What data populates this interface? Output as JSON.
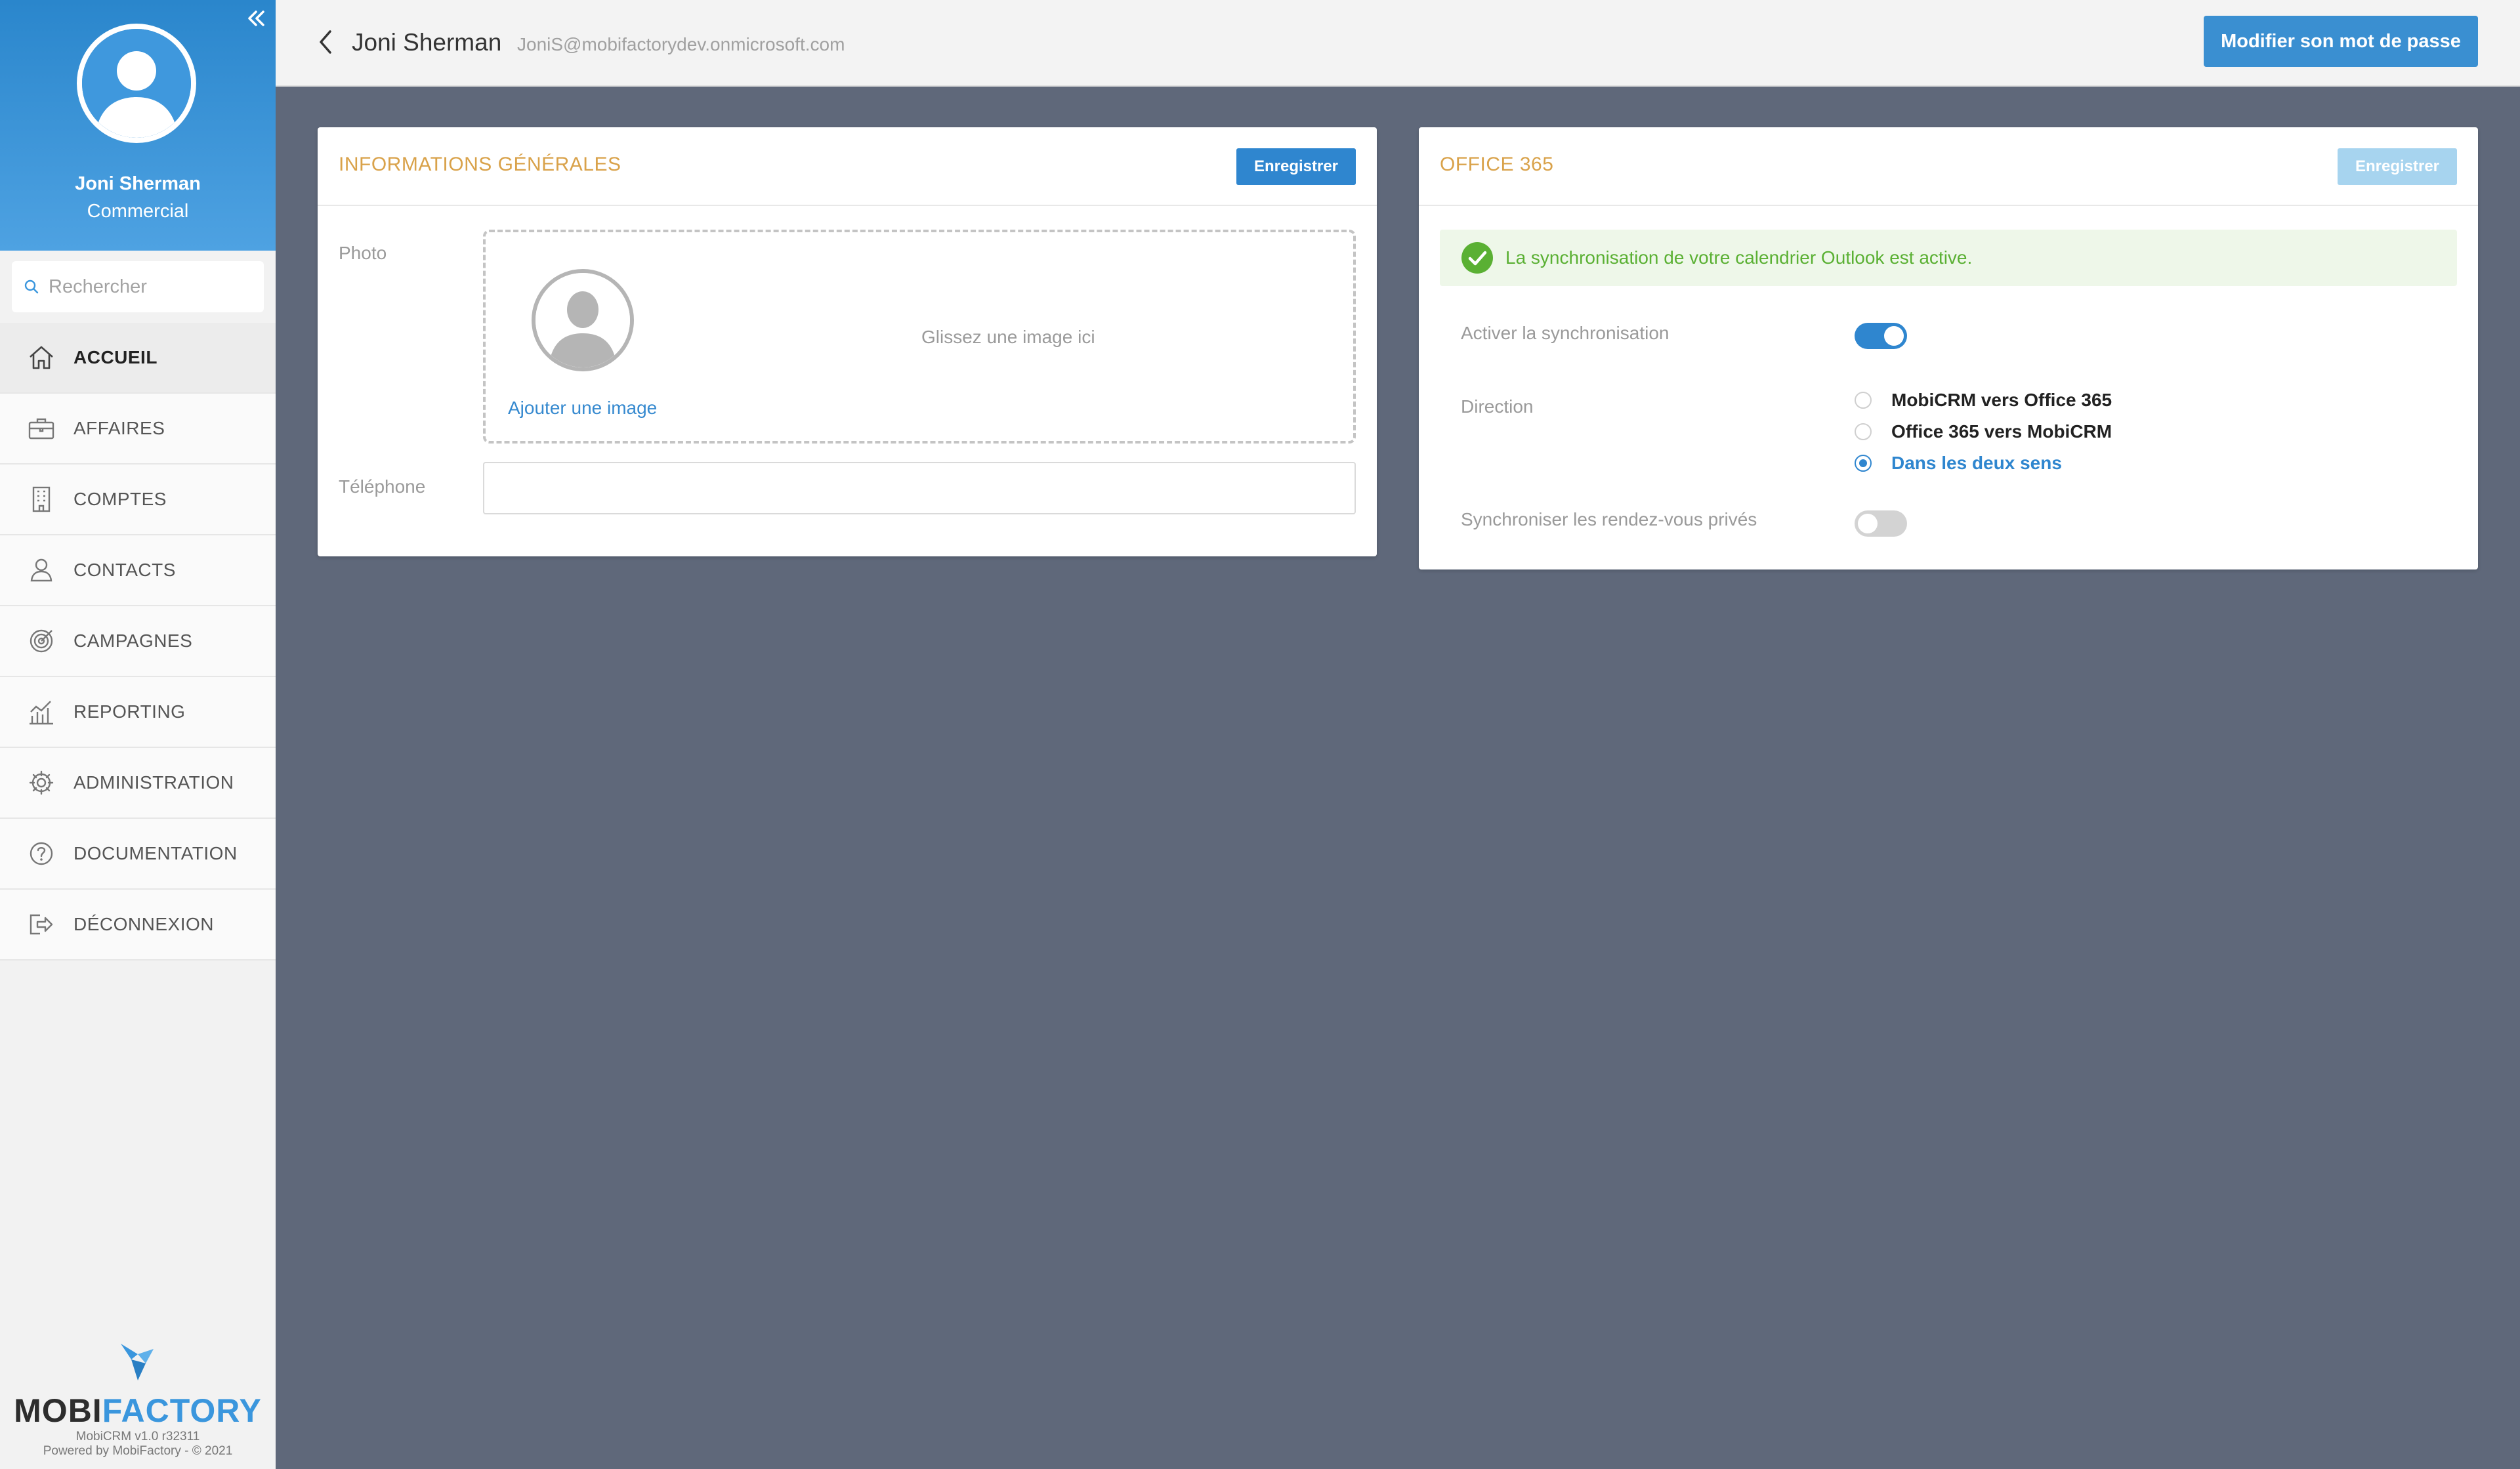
{
  "sidebar": {
    "user": {
      "name": "Joni Sherman",
      "role": "Commercial"
    },
    "search": {
      "placeholder": "Rechercher"
    },
    "nav": [
      {
        "label": "ACCUEIL",
        "icon": "home-icon",
        "active": true
      },
      {
        "label": "AFFAIRES",
        "icon": "briefcase-icon"
      },
      {
        "label": "COMPTES",
        "icon": "building-icon"
      },
      {
        "label": "CONTACTS",
        "icon": "person-icon"
      },
      {
        "label": "CAMPAGNES",
        "icon": "target-icon"
      },
      {
        "label": "REPORTING",
        "icon": "chart-icon"
      },
      {
        "label": "ADMINISTRATION",
        "icon": "gear-icon"
      },
      {
        "label": "DOCUMENTATION",
        "icon": "help-icon"
      },
      {
        "label": "DÉCONNEXION",
        "icon": "logout-icon"
      }
    ],
    "brand": {
      "logo_part1": "MOBI",
      "logo_part2": "FACTORY",
      "version": "MobiCRM v1.0 r32311",
      "powered": "Powered by MobiFactory - © 2021"
    }
  },
  "header": {
    "title": "Joni Sherman",
    "email": "JoniS@mobifactorydev.onmicrosoft.com",
    "password_button": "Modifier son mot de passe"
  },
  "general": {
    "title": "INFORMATIONS GÉNÉRALES",
    "save_label": "Enregistrer",
    "photo_label": "Photo",
    "add_image": "Ajouter une image",
    "drop_hint": "Glissez une image ici",
    "phone_label": "Téléphone",
    "phone_value": ""
  },
  "office": {
    "title": "OFFICE 365",
    "save_label": "Enregistrer",
    "alert": "La synchronisation de votre calendrier Outlook est active.",
    "sync_label": "Activer la synchronisation",
    "sync_on": true,
    "direction_label": "Direction",
    "directions": [
      {
        "label": "MobiCRM vers Office 365",
        "checked": false
      },
      {
        "label": "Office 365 vers MobiCRM",
        "checked": false
      },
      {
        "label": "Dans les deux sens",
        "checked": true
      }
    ],
    "private_label": "Synchroniser les rendez-vous privés",
    "private_on": false
  },
  "colors": {
    "accent": "#2f86cf",
    "section_title": "#d9a24a",
    "success": "#5ab033",
    "background": "#5f687a"
  }
}
